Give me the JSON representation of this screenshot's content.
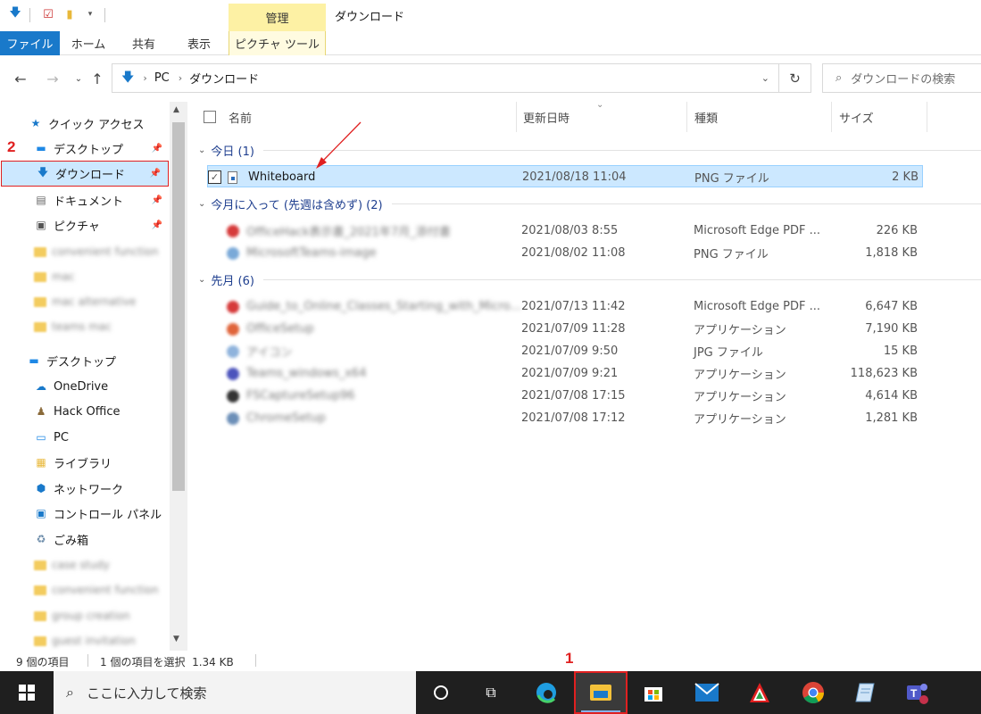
{
  "window_title": "ダウンロード",
  "context_tab_head": "管理",
  "ribbon": {
    "tabs": [
      "ファイル",
      "ホーム",
      "共有",
      "表示",
      "ピクチャ ツール"
    ]
  },
  "address": {
    "crumbs": [
      "PC",
      "ダウンロード"
    ]
  },
  "search": {
    "placeholder": "ダウンロードの検索"
  },
  "sidebar": {
    "quick_access": "クイック アクセス",
    "pinned": [
      {
        "label": "デスクトップ"
      },
      {
        "label": "ダウンロード"
      },
      {
        "label": "ドキュメント"
      },
      {
        "label": "ピクチャ"
      }
    ],
    "blurred_recent": [
      "convenient function",
      "mac",
      "mac alternative",
      "teams mac"
    ],
    "roots": [
      {
        "label": "デスクトップ",
        "icon": "desktop-icon"
      },
      {
        "label": "OneDrive",
        "icon": "cloud-icon"
      },
      {
        "label": "Hack Office",
        "icon": "user-icon"
      },
      {
        "label": "PC",
        "icon": "pc-icon"
      },
      {
        "label": "ライブラリ",
        "icon": "library-icon"
      },
      {
        "label": "ネットワーク",
        "icon": "network-icon"
      },
      {
        "label": "コントロール パネル",
        "icon": "control-panel-icon"
      },
      {
        "label": "ごみ箱",
        "icon": "recycle-bin-icon"
      }
    ],
    "blurred_folders": [
      "case study",
      "convenient function",
      "group creation",
      "guest invitation"
    ]
  },
  "columns": {
    "name": "名前",
    "date": "更新日時",
    "type": "種類",
    "size": "サイズ"
  },
  "groups": [
    {
      "label": "今日 (1)",
      "rows": [
        {
          "name": "Whiteboard",
          "date": "2021/08/18 11:04",
          "type": "PNG ファイル",
          "size": "2 KB",
          "selected": true,
          "blurred": false,
          "icon_color": "#2a6ebd"
        }
      ]
    },
    {
      "label": "今月に入って (先週は含めず) (2)",
      "rows": [
        {
          "name": "OfficeHack表示書_2021年7月_添付書",
          "date": "2021/08/03 8:55",
          "type": "Microsoft Edge PDF ...",
          "size": "226 KB",
          "blurred": true,
          "icon_color": "#d63a3a"
        },
        {
          "name": "MicrosoftTeams-image",
          "date": "2021/08/02 11:08",
          "type": "PNG ファイル",
          "size": "1,818 KB",
          "blurred": true,
          "icon_color": "#7aa9d8"
        }
      ]
    },
    {
      "label": "先月 (6)",
      "rows": [
        {
          "name": "Guide_to_Online_Classes_Starting_with_Micro...",
          "date": "2021/07/13 11:42",
          "type": "Microsoft Edge PDF ...",
          "size": "6,647 KB",
          "blurred": true,
          "icon_color": "#d63a3a"
        },
        {
          "name": "OfficeSetup",
          "date": "2021/07/09 11:28",
          "type": "アプリケーション",
          "size": "7,190 KB",
          "blurred": true,
          "icon_color": "#e0643a"
        },
        {
          "name": "アイコン",
          "date": "2021/07/09 9:50",
          "type": "JPG ファイル",
          "size": "15 KB",
          "blurred": true,
          "icon_color": "#8fb3dc"
        },
        {
          "name": "Teams_windows_x64",
          "date": "2021/07/09 9:21",
          "type": "アプリケーション",
          "size": "118,623 KB",
          "blurred": true,
          "icon_color": "#4b53bc"
        },
        {
          "name": "FSCaptureSetup96",
          "date": "2021/07/08 17:15",
          "type": "アプリケーション",
          "size": "4,614 KB",
          "blurred": true,
          "icon_color": "#333333"
        },
        {
          "name": "ChromeSetup",
          "date": "2021/07/08 17:12",
          "type": "アプリケーション",
          "size": "1,281 KB",
          "blurred": true,
          "icon_color": "#6c8fb8"
        }
      ]
    }
  ],
  "status": {
    "count": "9 個の項目",
    "selection": "1 個の項目を選択  1.34 KB"
  },
  "taskbar": {
    "search_placeholder": "ここに入力して検索"
  },
  "annotations": [
    "1",
    "2"
  ],
  "colors": {
    "accent": "#1979ca",
    "selection_bg": "#cce8ff",
    "annotation_red": "#e02020",
    "taskbar_bg": "#1f1f1f",
    "context_tab": "#fdf1a4"
  }
}
